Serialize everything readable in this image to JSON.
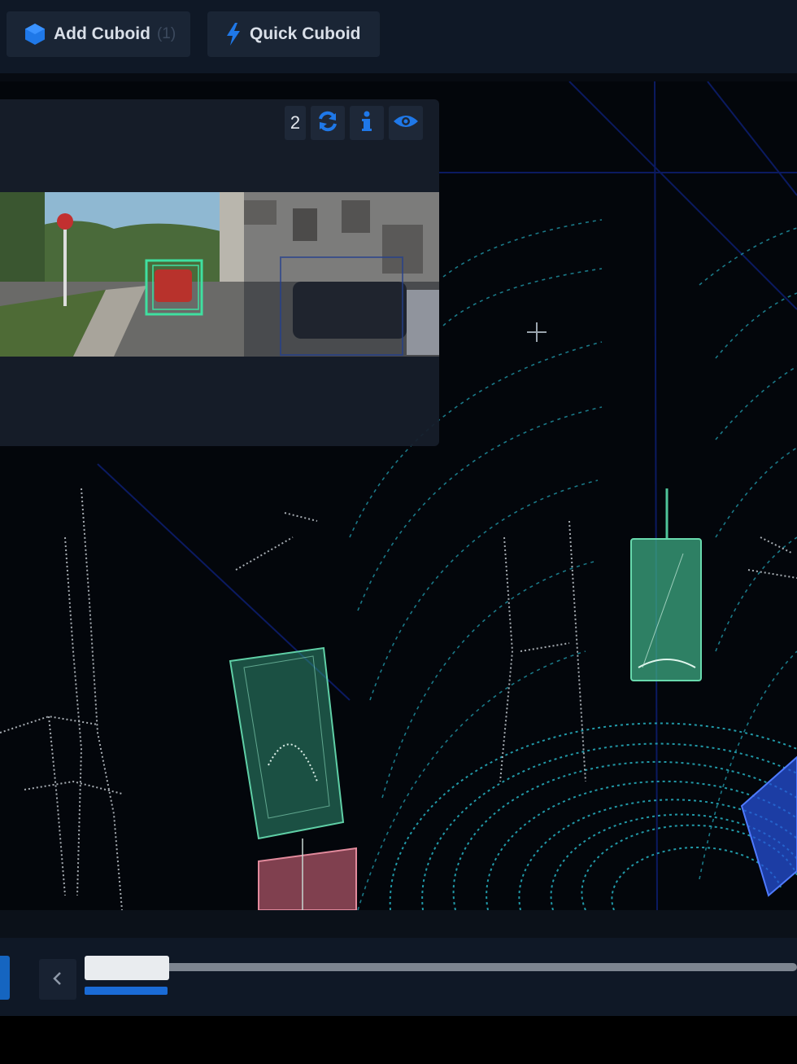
{
  "toolbar": {
    "add_cuboid_label": "Add Cuboid",
    "add_cuboid_shortcut": "(1)",
    "quick_cuboid_label": "Quick Cuboid"
  },
  "camera_panel": {
    "camera_index": "2",
    "controls": [
      "refresh-icon",
      "info-icon",
      "eye-icon"
    ]
  },
  "scene": {
    "cuboids": [
      {
        "name": "green-cuboid-left",
        "color": "#3fae8c"
      },
      {
        "name": "green-cuboid-right",
        "color": "#4fc49a"
      },
      {
        "name": "pink-cuboid",
        "color": "#d9768a"
      },
      {
        "name": "blue-cuboid",
        "color": "#2e5ee6"
      }
    ]
  },
  "timeline": {
    "current_position_fraction": 0.11,
    "prev_icon": "chevron-left-icon"
  },
  "colors": {
    "accent": "#1a6bd6",
    "toolbar_bg": "#0f1826",
    "viewport_bg": "#03060b",
    "lidar": "#2bb3c0"
  }
}
